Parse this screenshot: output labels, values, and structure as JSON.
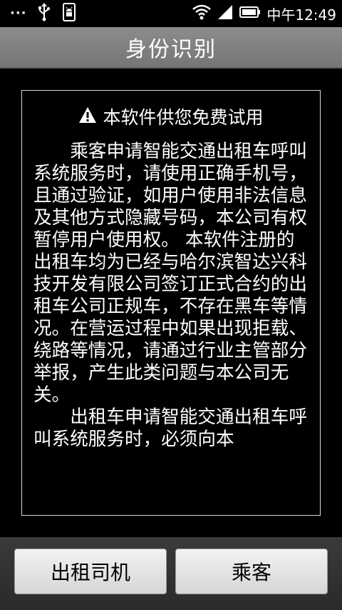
{
  "status_bar": {
    "overflow_dots": "···",
    "time": "中午12:49",
    "icons": [
      "overflow-dots-icon",
      "usb-icon",
      "android-debug-icon",
      "wifi-icon",
      "signal-icon",
      "battery-icon"
    ]
  },
  "dialog": {
    "title": "身份识别",
    "notice_title": "本软件供您免费试用",
    "paragraphs": [
      "乘客申请智能交通出租车呼叫系统服务时，请使用正确手机号，且通过验证，如用户使用非法信息及其他方式隐藏号码，本公司有权暂停用户使用权。 本软件注册的出租车均为已经与哈尔滨智达兴科技开发有限公司签订正式合约的出租车公司正规车，不存在黑车等情况。在营运过程中如果出现拒载、绕路等情况，请通过行业主管部分举报，产生此类问题与本公司无关。",
      "出租车申请智能交通出租车呼叫系统服务时，必须向本"
    ]
  },
  "buttons": {
    "driver_label": "出租司机",
    "passenger_label": "乘客"
  },
  "colors": {
    "title_bar": "#808080",
    "background": "#000000",
    "button_face": "#e6e6e6",
    "bottom_bar": "#333333"
  }
}
